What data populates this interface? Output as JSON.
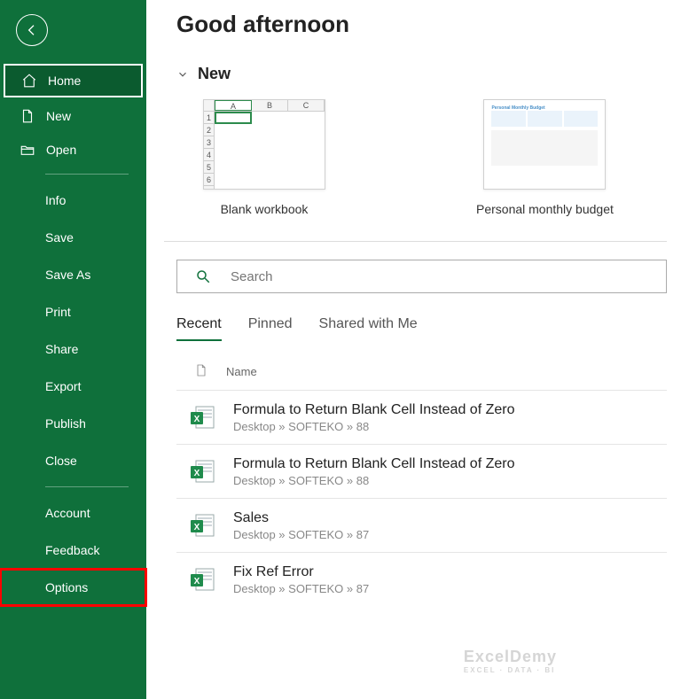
{
  "greeting": "Good afternoon",
  "sidebar": {
    "primary": [
      {
        "label": "Home",
        "icon": "home",
        "selected": true
      },
      {
        "label": "New",
        "icon": "doc"
      },
      {
        "label": "Open",
        "icon": "folder"
      }
    ],
    "file_ops": [
      {
        "label": "Info"
      },
      {
        "label": "Save"
      },
      {
        "label": "Save As"
      },
      {
        "label": "Print"
      },
      {
        "label": "Share"
      },
      {
        "label": "Export"
      },
      {
        "label": "Publish"
      },
      {
        "label": "Close"
      }
    ],
    "footer": [
      {
        "label": "Account"
      },
      {
        "label": "Feedback"
      },
      {
        "label": "Options",
        "highlight": true
      }
    ]
  },
  "new_section": {
    "title": "New",
    "templates": [
      {
        "label": "Blank workbook",
        "kind": "blank"
      },
      {
        "label": "Personal monthly budget",
        "kind": "budget",
        "thumb_title": "Personal Monthly Budget"
      }
    ]
  },
  "search": {
    "placeholder": "Search"
  },
  "tabs": [
    {
      "label": "Recent",
      "active": true
    },
    {
      "label": "Pinned"
    },
    {
      "label": "Shared with Me"
    }
  ],
  "list_header": {
    "name_col": "Name"
  },
  "recent_files": [
    {
      "name": "Formula to Return Blank Cell Instead of Zero",
      "path": "Desktop » SOFTEKO » 88"
    },
    {
      "name": "Formula to Return Blank Cell Instead of Zero",
      "path": "Desktop » SOFTEKO » 88"
    },
    {
      "name": "Sales",
      "path": "Desktop » SOFTEKO » 87"
    },
    {
      "name": "Fix Ref Error",
      "path": "Desktop » SOFTEKO » 87"
    }
  ],
  "watermark": {
    "main": "ExcelDemy",
    "sub": "EXCEL · DATA · BI"
  }
}
